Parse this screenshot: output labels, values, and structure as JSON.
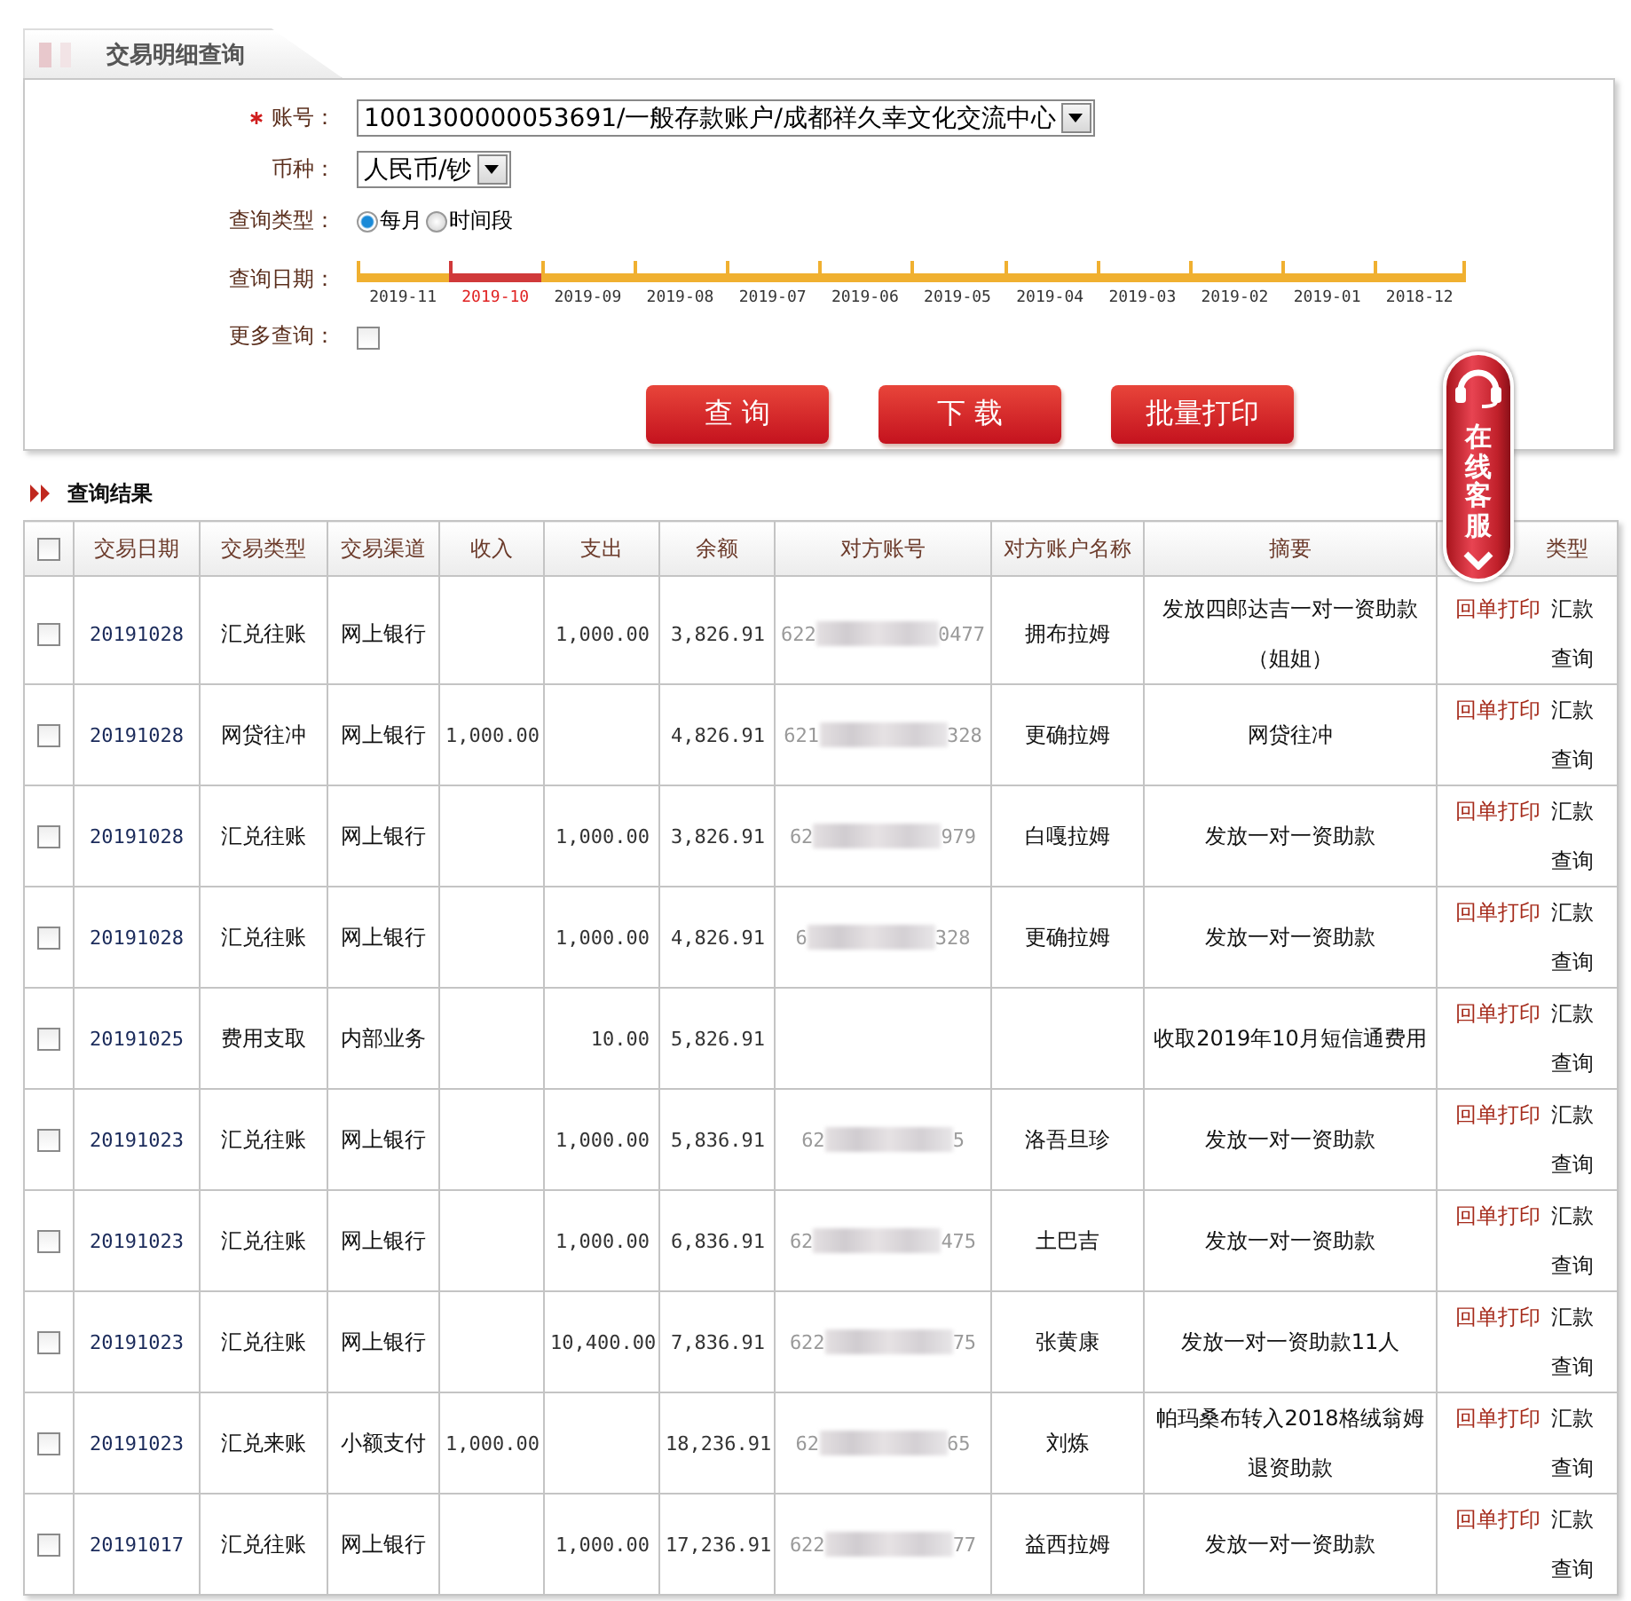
{
  "tab": {
    "title": "交易明细查询"
  },
  "form": {
    "account": {
      "label": "账号：",
      "required": true,
      "value": "1001300000053691/一般存款账户/成都祥久幸文化交流中心"
    },
    "currency": {
      "label": "币种：",
      "value": "人民币/钞"
    },
    "query_type": {
      "label": "查询类型：",
      "options": [
        {
          "label": "每月",
          "selected": true
        },
        {
          "label": "时间段",
          "selected": false
        }
      ]
    },
    "date": {
      "label": "查询日期：",
      "months": [
        {
          "label": "2019-11",
          "selected": false
        },
        {
          "label": "2019-10",
          "selected": true
        },
        {
          "label": "2019-09",
          "selected": false
        },
        {
          "label": "2019-08",
          "selected": false
        },
        {
          "label": "2019-07",
          "selected": false
        },
        {
          "label": "2019-06",
          "selected": false
        },
        {
          "label": "2019-05",
          "selected": false
        },
        {
          "label": "2019-04",
          "selected": false
        },
        {
          "label": "2019-03",
          "selected": false
        },
        {
          "label": "2019-02",
          "selected": false
        },
        {
          "label": "2019-01",
          "selected": false
        },
        {
          "label": "2018-12",
          "selected": false
        }
      ]
    },
    "more": {
      "label": "更多查询：",
      "checked": false
    },
    "buttons": [
      "查 询",
      "下 载",
      "批量打印"
    ]
  },
  "chat_widget": {
    "label": "在线客服"
  },
  "results": {
    "title": "查询结果",
    "select_all": {
      "checked": false
    },
    "columns": [
      "交易日期",
      "交易类型",
      "交易渠道",
      "收入",
      "支出",
      "余额",
      "对方账号",
      "对方账户名称",
      "摘要",
      "类型"
    ],
    "rows": [
      {
        "checked": false,
        "date": "20191028",
        "type": "汇兑往账",
        "channel": "网上银行",
        "expense": "1,000.00",
        "balance": "3,826.91",
        "account": {
          "start": "622",
          "end": "0477"
        },
        "name": "拥布拉姆",
        "summary": "发放四郎达吉一对一资助款（姐姐）",
        "actions": [
          "回单打印",
          "汇款查询"
        ]
      },
      {
        "checked": false,
        "date": "20191028",
        "type": "网贷往冲",
        "channel": "网上银行",
        "income": "1,000.00",
        "balance": "4,826.91",
        "account": {
          "start": "621",
          "end": "328"
        },
        "name": "更确拉姆",
        "summary": "网贷往冲",
        "actions": [
          "回单打印",
          "汇款查询"
        ]
      },
      {
        "checked": false,
        "date": "20191028",
        "type": "汇兑往账",
        "channel": "网上银行",
        "expense": "1,000.00",
        "balance": "3,826.91",
        "account": {
          "start": "62",
          "end": "979"
        },
        "name": "白嘎拉姆",
        "summary": "发放一对一资助款",
        "actions": [
          "回单打印",
          "汇款查询"
        ]
      },
      {
        "checked": false,
        "date": "20191028",
        "type": "汇兑往账",
        "channel": "网上银行",
        "expense": "1,000.00",
        "balance": "4,826.91",
        "account": {
          "start": "6",
          "end": "328"
        },
        "name": "更确拉姆",
        "summary": "发放一对一资助款",
        "actions": [
          "回单打印",
          "汇款查询"
        ]
      },
      {
        "checked": false,
        "date": "20191025",
        "type": "费用支取",
        "channel": "内部业务",
        "expense": "10.00",
        "balance": "5,826.91",
        "summary": "收取2019年10月短信通费用",
        "actions": [
          "回单打印",
          "汇款查询"
        ]
      },
      {
        "checked": false,
        "date": "20191023",
        "type": "汇兑往账",
        "channel": "网上银行",
        "expense": "1,000.00",
        "balance": "5,836.91",
        "account": {
          "start": "62",
          "end": "5"
        },
        "name": "洛吾旦珍",
        "summary": "发放一对一资助款",
        "actions": [
          "回单打印",
          "汇款查询"
        ]
      },
      {
        "checked": false,
        "date": "20191023",
        "type": "汇兑往账",
        "channel": "网上银行",
        "expense": "1,000.00",
        "balance": "6,836.91",
        "account": {
          "start": "62",
          "end": "475"
        },
        "name": "土巴吉",
        "summary": "发放一对一资助款",
        "actions": [
          "回单打印",
          "汇款查询"
        ]
      },
      {
        "checked": false,
        "date": "20191023",
        "type": "汇兑往账",
        "channel": "网上银行",
        "expense": "10,400.00",
        "balance": "7,836.91",
        "account": {
          "start": "622",
          "end": "75"
        },
        "name": "张黄康",
        "summary": "发放一对一资助款11人",
        "actions": [
          "回单打印",
          "汇款查询"
        ]
      },
      {
        "checked": false,
        "date": "20191023",
        "type": "汇兑来账",
        "channel": "小额支付",
        "income": "1,000.00",
        "balance": "18,236.91",
        "account": {
          "start": "62",
          "end": "65"
        },
        "name": "刘炼",
        "summary": "帕玛桑布转入2018格绒翁姆退资助款",
        "actions": [
          "回单打印",
          "汇款查询"
        ]
      },
      {
        "checked": false,
        "date": "20191017",
        "type": "汇兑往账",
        "channel": "网上银行",
        "expense": "1,000.00",
        "balance": "17,236.91",
        "account": {
          "start": "622",
          "end": "77"
        },
        "name": "益西拉姆",
        "summary": "发放一对一资助款",
        "actions": [
          "回单打印",
          "汇款查询"
        ]
      }
    ]
  }
}
